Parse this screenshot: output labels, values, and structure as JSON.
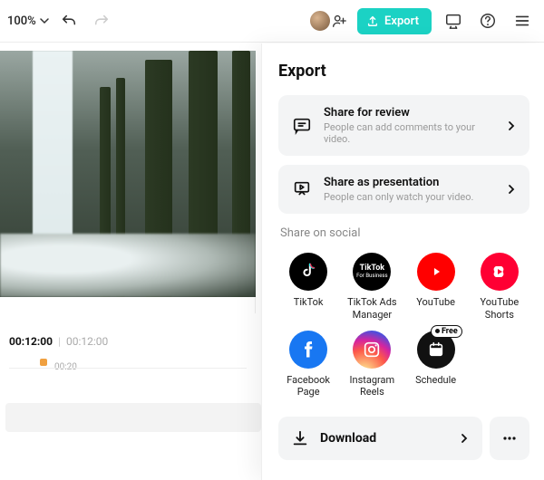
{
  "header": {
    "zoom_label": "100%",
    "export_btn": "Export"
  },
  "timeline": {
    "current": "00:12:00",
    "duration": "00:12:00",
    "tick": "00:20"
  },
  "export_panel": {
    "title": "Export",
    "options": [
      {
        "title": "Share for review",
        "subtitle": "People can add comments to your video."
      },
      {
        "title": "Share as presentation",
        "subtitle": "People can only watch your video."
      }
    ],
    "social_label": "Share on social",
    "socials": [
      {
        "label": "TikTok"
      },
      {
        "label": "TikTok Ads Manager"
      },
      {
        "label": "YouTube"
      },
      {
        "label": "YouTube Shorts"
      },
      {
        "label": "Facebook Page"
      },
      {
        "label": "Instagram Reels"
      },
      {
        "label": "Schedule",
        "badge": "Free"
      }
    ],
    "download_label": "Download"
  },
  "icons": {
    "chevron_down": "chevron-down-icon",
    "undo": "undo-icon",
    "redo": "redo-icon",
    "avatar": "avatar-icon",
    "add_person": "add-person-icon",
    "upload": "upload-icon",
    "device": "device-icon",
    "help": "help-icon",
    "menu": "menu-icon",
    "chat": "chat-icon",
    "presentation": "presentation-icon",
    "chevron_right": "chevron-right-icon",
    "download": "download-icon",
    "more": "more-icon"
  },
  "colors": {
    "accent": "#1bd2c4",
    "youtube": "#ff0000",
    "shorts": "#ff0033",
    "facebook": "#1877f2"
  }
}
